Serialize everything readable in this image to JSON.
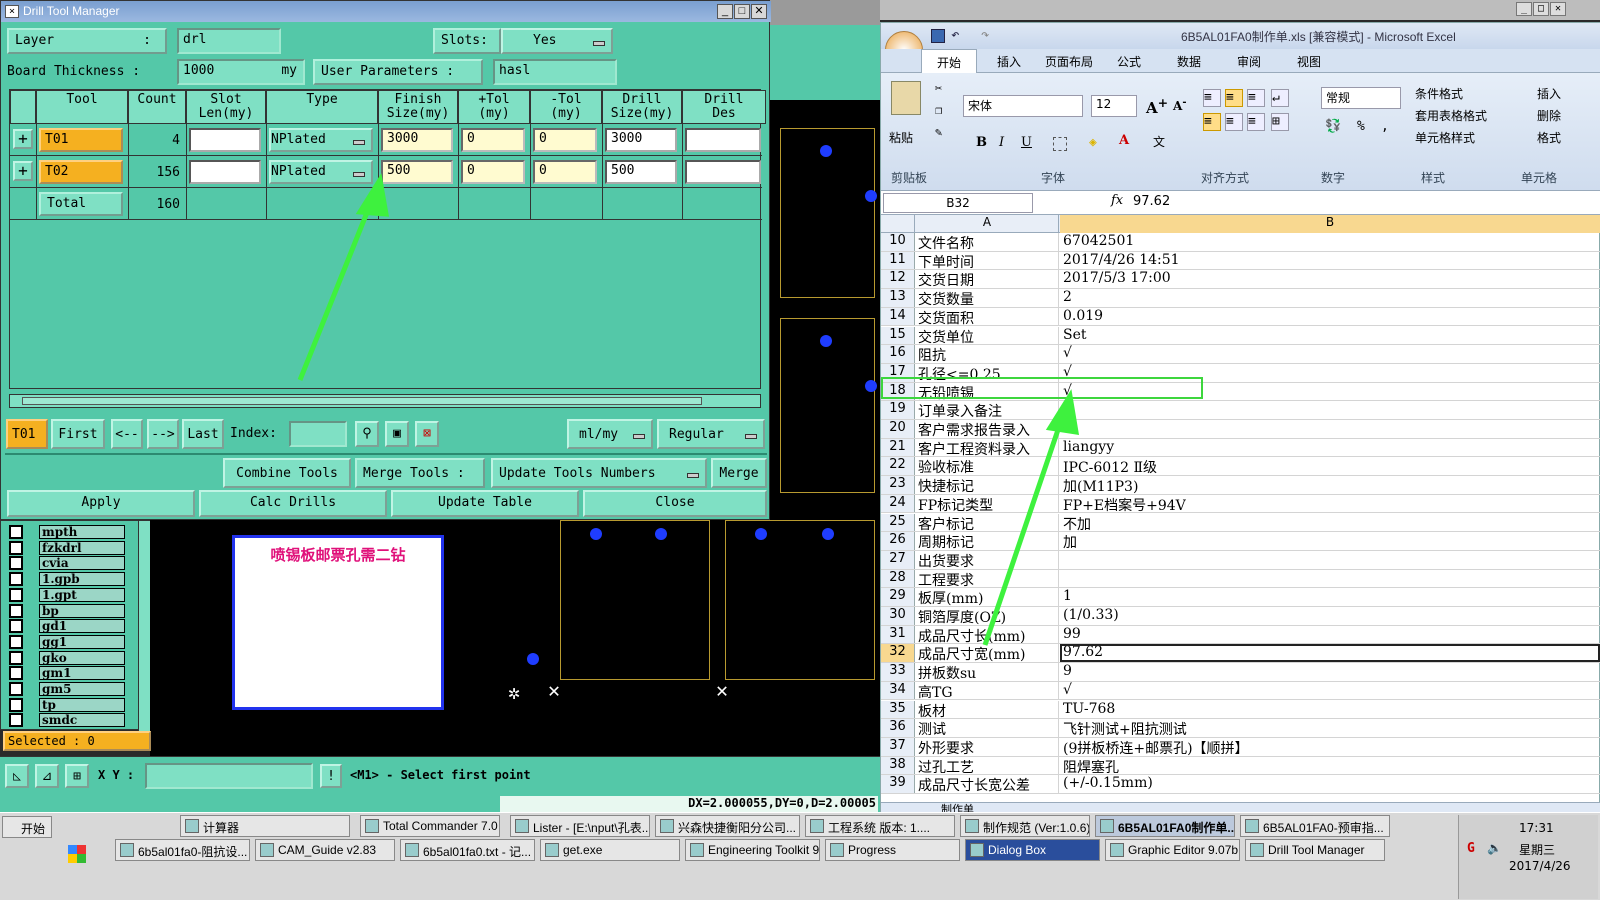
{
  "dtm": {
    "title": "Drill Tool Manager",
    "layer_label": "Layer",
    "layer_colon": ":",
    "layer_value": "drl",
    "slots_label": "Slots:",
    "slots_value": "Yes",
    "board_label": "Board Thickness :",
    "board_value": "1000",
    "board_unit": "my",
    "userparams_label": "User Parameters :",
    "userparams_value": "hasl",
    "columns": [
      "Tool",
      "Count",
      "Slot\nLen(my)",
      "Type",
      "Finish\nSize(my)",
      "+Tol\n(my)",
      "-Tol\n(my)",
      "Drill\nSize(my)",
      "Drill\nDes"
    ],
    "rows": [
      {
        "tool": "T01",
        "count": "4",
        "type": "NPlated",
        "finish": "3000",
        "ptol": "0",
        "ntol": "0",
        "drill": "3000"
      },
      {
        "tool": "T02",
        "count": "156",
        "type": "NPlated",
        "finish": "500",
        "ptol": "0",
        "ntol": "0",
        "drill": "500"
      }
    ],
    "total_label": "Total",
    "total_count": "160",
    "nav": {
      "current": "T01",
      "first": "First",
      "prev": "<--",
      "next": "-->",
      "last": "Last",
      "index_label": "Index:",
      "units": "ml/my",
      "mode": "Regular"
    },
    "buttons": {
      "combine": "Combine Tools",
      "merge_tools": "Merge Tools :",
      "update_numbers": "Update Tools Numbers",
      "merge": "Merge",
      "apply": "Apply",
      "calc": "Calc Drills",
      "update_table": "Update Table",
      "close": "Close"
    }
  },
  "layers": [
    "mpth",
    "fzkdrl",
    "cvia",
    "1.gpb",
    "1.gpt",
    "bp",
    "gd1",
    "gg1",
    "gko",
    "gm1",
    "gm5",
    "tp",
    "smdc"
  ],
  "selected": "Selected : 0",
  "xy_label": "X Y :",
  "status_msg": "<M1> - Select first point",
  "dx_readout": "DX=2.000055,DY=0,D=2.00005",
  "annotation": "喷锡板邮票孔需二钻",
  "excel": {
    "title": "6B5AL01FA0制作单.xls [兼容模式] - Microsoft Excel",
    "tabs": [
      "开始",
      "插入",
      "页面布局",
      "公式",
      "数据",
      "审阅",
      "视图"
    ],
    "font_name": "宋体",
    "font_size": "12",
    "number_format": "常规",
    "groups": [
      "剪贴板",
      "字体",
      "对齐方式",
      "数字",
      "样式",
      "单元格"
    ],
    "paste": "粘贴",
    "styles": [
      "条件格式",
      "套用表格格式",
      "单元格样式"
    ],
    "cells_btns": [
      "插入",
      "删除",
      "格式"
    ],
    "namebox": "B32",
    "formula": "97.62",
    "col_a": "A",
    "col_b": "B",
    "sheet_tab": "制作单",
    "rows": [
      {
        "n": "10",
        "a": "文件名称",
        "b": "67042501"
      },
      {
        "n": "11",
        "a": "下单时间",
        "b": "2017/4/26 14:51"
      },
      {
        "n": "12",
        "a": "交货日期",
        "b": "2017/5/3 17:00"
      },
      {
        "n": "13",
        "a": "交货数量",
        "b": "2"
      },
      {
        "n": "14",
        "a": "交货面积",
        "b": "0.019"
      },
      {
        "n": "15",
        "a": "交货单位",
        "b": "Set"
      },
      {
        "n": "16",
        "a": "阻抗",
        "b": "√"
      },
      {
        "n": "17",
        "a": "孔径<=0.25",
        "b": "√"
      },
      {
        "n": "18",
        "a": "无铅喷锡",
        "b": "√"
      },
      {
        "n": "19",
        "a": "订单录入备注",
        "b": ""
      },
      {
        "n": "20",
        "a": "客户需求报告录入",
        "b": ""
      },
      {
        "n": "21",
        "a": "客户工程资料录入",
        "b": "liangyy"
      },
      {
        "n": "22",
        "a": "验收标准",
        "b": "IPC-6012 Ⅱ级"
      },
      {
        "n": "23",
        "a": "快捷标记",
        "b": "加(M11P3)"
      },
      {
        "n": "24",
        "a": "FP标记类型",
        "b": "FP+E档案号+94V"
      },
      {
        "n": "25",
        "a": "客户标记",
        "b": "不加"
      },
      {
        "n": "26",
        "a": "周期标记",
        "b": "加"
      },
      {
        "n": "27",
        "a": "出货要求",
        "b": ""
      },
      {
        "n": "28",
        "a": "工程要求",
        "b": ""
      },
      {
        "n": "29",
        "a": "板厚(mm)",
        "b": "1"
      },
      {
        "n": "30",
        "a": "铜箔厚度(OZ)",
        "b": "(1/0.33)"
      },
      {
        "n": "31",
        "a": "成品尺寸长(mm)",
        "b": "99"
      },
      {
        "n": "32",
        "a": "成品尺寸宽(mm)",
        "b": "97.62"
      },
      {
        "n": "33",
        "a": "拼板数su",
        "b": "9"
      },
      {
        "n": "34",
        "a": "高TG",
        "b": "√"
      },
      {
        "n": "35",
        "a": "板材",
        "b": "TU-768"
      },
      {
        "n": "36",
        "a": "测试",
        "b": "飞针测试+阻抗测试"
      },
      {
        "n": "37",
        "a": "外形要求",
        "b": "(9拼板桥连+邮票孔)【顺拼】"
      },
      {
        "n": "38",
        "a": "过孔工艺",
        "b": "阻焊塞孔"
      },
      {
        "n": "39",
        "a": "成品尺寸长宽公差",
        "b": "(+/-0.15mm)"
      }
    ]
  },
  "taskbar": {
    "start": "开始",
    "row1": [
      "计算器",
      "Total Commander 7.0 ...",
      "Lister - [E:\\nput\\孔表...",
      "兴森快捷衡阳分公司...",
      "工程系统 版本: 1....",
      "制作规范 (Ver:1.0.6)",
      "6B5AL01FA0制作单...",
      "6B5AL01FA0-预审指..."
    ],
    "row2": [
      "6b5al01fa0-阻抗设...",
      "CAM_Guide v2.83",
      "6b5al01fa0.txt - 记...",
      "get.exe",
      "Engineering Toolkit 9....",
      "Progress",
      "Dialog Box",
      "Graphic Editor 9.07b...",
      "Drill Tool Manager"
    ],
    "time": "17:31",
    "weekday": "星期三",
    "date": "2017/4/26"
  }
}
